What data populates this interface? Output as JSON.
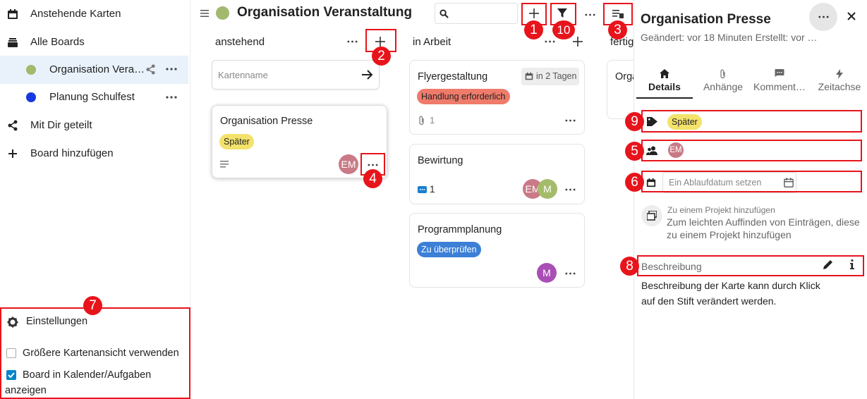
{
  "sidebar": {
    "items": [
      {
        "label": "Anstehende Karten",
        "icon": "calendar-icon"
      },
      {
        "label": "Alle Boards",
        "icon": "boards-archive-icon"
      },
      {
        "label": "Organisation Vera…",
        "icon": "board-color-dot",
        "color": "#a2b96e"
      },
      {
        "label": "Planung Schulfest",
        "icon": "board-color-dot",
        "color": "#1638e0"
      },
      {
        "label": "Mit Dir geteilt",
        "icon": "share-icon"
      },
      {
        "label": "Board hinzufügen",
        "icon": "plus-icon"
      }
    ],
    "settings": {
      "title": "Einstellungen",
      "option1": "Größere Kartenansicht verwenden",
      "option1_checked": false,
      "option2_line1": "Board in Kalender/Aufgaben",
      "option2_line2": "anzeigen",
      "option2_checked": true
    }
  },
  "header": {
    "board_title": "Organisation Veranstaltung",
    "board_color": "#a2b96e"
  },
  "columns": [
    {
      "title": "anstehend"
    },
    {
      "title": "in Arbeit"
    },
    {
      "title": "fertig"
    }
  ],
  "new_card": {
    "placeholder": "Kartenname"
  },
  "cards": {
    "presse": {
      "title": "Organisation Presse",
      "tag": "Später",
      "avatar": "EM"
    },
    "flyer": {
      "title": "Flyergestaltung",
      "due": "in 2 Tagen",
      "tag": "Handlung erforderlich",
      "attachments": "1"
    },
    "bewirtung": {
      "title": "Bewirtung",
      "comments": "1",
      "avatar1": "EM",
      "avatar2": "M"
    },
    "programm": {
      "title": "Programmplanung",
      "tag": "Zu überprüfen",
      "avatar": "M"
    },
    "fertig_card": {
      "title": "Orga"
    }
  },
  "panel": {
    "title": "Organisation Presse",
    "subtitle": "Geändert: vor 18 Minuten Erstellt: vor …",
    "tabs": [
      "Details",
      "Anhänge",
      "Komment…",
      "Zeitachse"
    ],
    "tag": "Später",
    "assignee": "EM",
    "due_placeholder": "Ein Ablaufdatum setzen",
    "project_title": "Zu einem Projekt hinzufügen",
    "project_hint_line1": "Zum leichten Auffinden von Einträgen, diese",
    "project_hint_line2": "zu einem Projekt hinzufügen",
    "description_label": "Beschreibung",
    "description_line1": "Beschreibung der Karte kann durch Klick",
    "description_line2": "auf den Stift verändert werden."
  },
  "annotations": [
    "1",
    "2",
    "3",
    "4",
    "5",
    "6",
    "7",
    "8",
    "9",
    "10"
  ],
  "colors": {
    "annotation_red": "#e8141c",
    "tag_spaeter": "#f3e26b",
    "tag_handlung": "#ef7b6b",
    "tag_ueberpruefen": "#3b7fd6",
    "avatar_em": "#c97a86",
    "avatar_m": "#a84fb5",
    "active_nav": "#e9f2fb"
  }
}
